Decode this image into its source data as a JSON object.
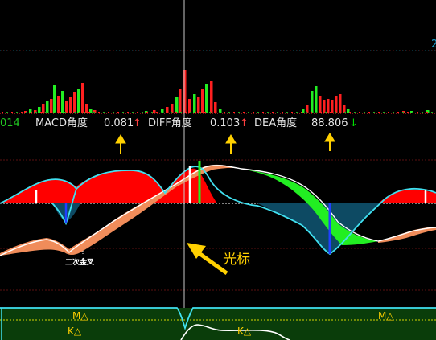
{
  "colors": {
    "background": "#000000",
    "label": "#e6e6e6",
    "value_up": "#e6e6e6",
    "arrow_up": "#ff4040",
    "arrow_down": "#00e000",
    "annotation": "#ffd000",
    "ma_line": "#40e0f0",
    "red_fill": "#ff0000",
    "teal_fill": "#0d4a63",
    "green_fill": "#22ee22",
    "orange_fill": "#f08c5a",
    "cross_label": "#ffffff",
    "panel_green": "#0a3d0a",
    "mk_label": "#ffd000",
    "gridline": "#5a1010",
    "cursor": "#c8c8c8"
  },
  "top_panel": {
    "corner_label": "2"
  },
  "readout": {
    "left_cut": "014",
    "macd_label": "MACD角度",
    "macd_value": "0.081",
    "macd_arrow": "↑",
    "diff_label": "DIFF角度",
    "diff_value": "0.103",
    "diff_arrow": "↑",
    "dea_label": "DEA角度",
    "dea_value": "88.806",
    "dea_arrow": "↓"
  },
  "annotations": {
    "cursor_label": "光标",
    "second_cross_label": "二次金叉"
  },
  "bottom_panel": {
    "m_label_1": "M△",
    "m_label_2": "M△",
    "k_label_1": "K△",
    "k_label_2": "K△"
  }
}
